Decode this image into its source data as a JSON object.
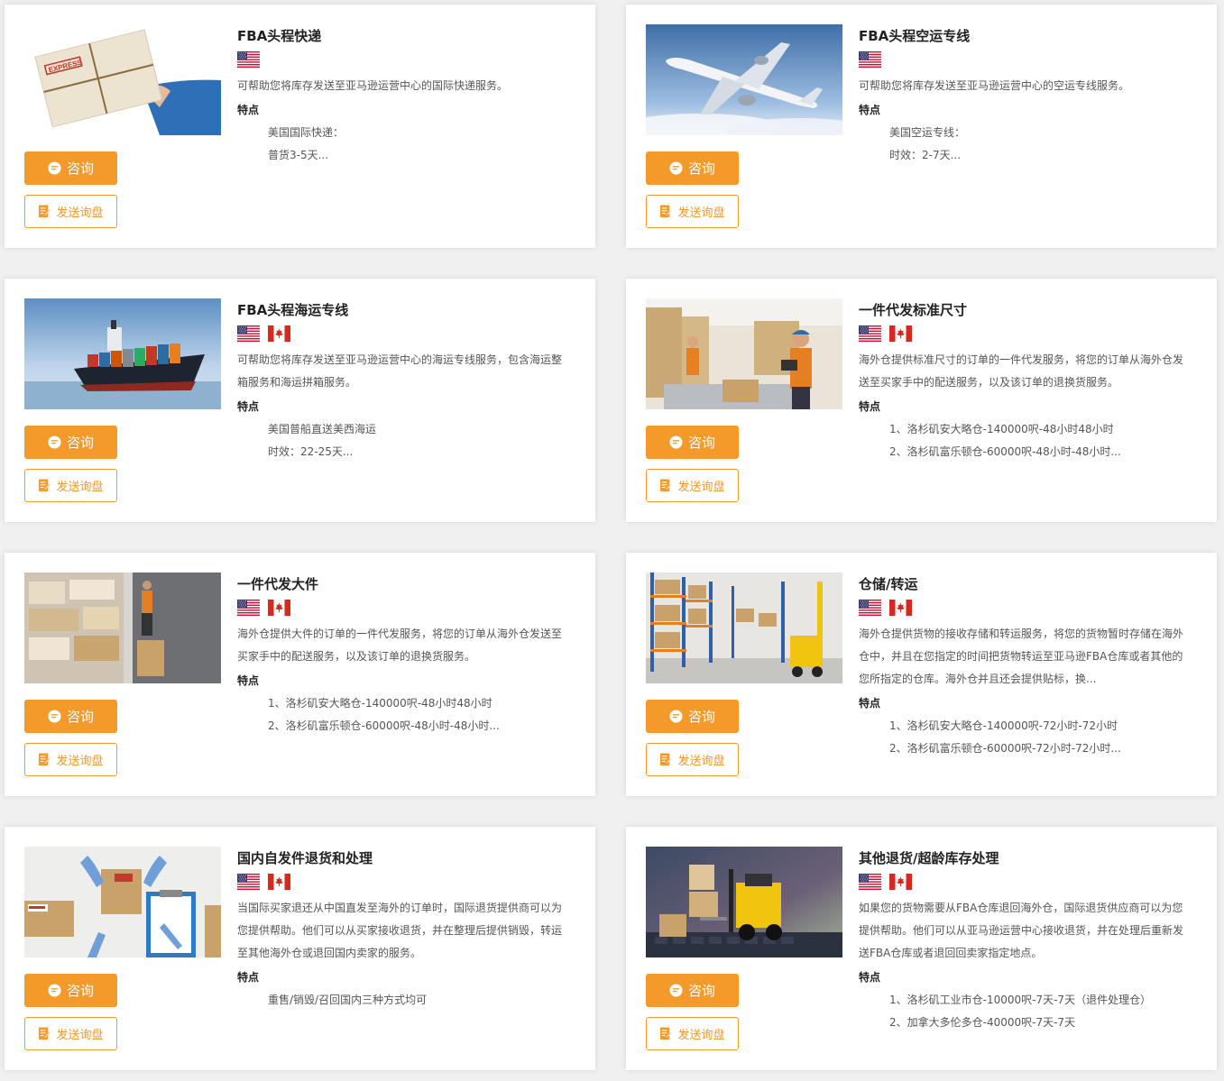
{
  "buttons": {
    "consult": "咨询",
    "inquiry": "发送询盘"
  },
  "features_label": "特点",
  "colors": {
    "accent": "#f39a2b"
  },
  "cards": [
    {
      "title": "FBA头程快递",
      "flags": [
        "us-flag"
      ],
      "image": "express-package-photo",
      "desc": "可帮助您将库存发送至亚马逊运营中心的国际快递服务。",
      "features": [
        "美国国际快递：",
        "普货3-5天..."
      ]
    },
    {
      "title": "FBA头程空运专线",
      "flags": [
        "us-flag"
      ],
      "image": "airplane-photo",
      "desc": "可帮助您将库存发送至亚马逊运营中心的空运专线服务。",
      "features": [
        "美国空运专线：",
        "时效：2-7天..."
      ]
    },
    {
      "title": "FBA头程海运专线",
      "flags": [
        "us-flag",
        "ca-flag"
      ],
      "image": "container-ship-photo",
      "desc": "可帮助您将库存发送至亚马逊运营中心的海运专线服务，包含海运整箱服务和海运拼箱服务。",
      "features": [
        "美国普船直送美西海运",
        "时效：22-25天..."
      ]
    },
    {
      "title": "一件代发标准尺寸",
      "flags": [
        "us-flag",
        "ca-flag"
      ],
      "image": "warehouse-worker-photo",
      "desc": "海外仓提供标准尺寸的订单的一件代发服务，将您的订单从海外仓发送至买家手中的配送服务，以及该订单的退换货服务。",
      "features": [
        "1、洛杉矶安大略仓-140000呎-48小时48小时",
        "2、洛杉矶富乐顿仓-60000呎-48小时-48小时..."
      ]
    },
    {
      "title": "一件代发大件",
      "flags": [
        "us-flag",
        "ca-flag"
      ],
      "image": "warehouse-boxes-photo",
      "desc": "海外仓提供大件的订单的一件代发服务，将您的订单从海外仓发送至买家手中的配送服务，以及该订单的退换货服务。",
      "features": [
        "1、洛杉矶安大略仓-140000呎-48小时48小时",
        "2、洛杉矶富乐顿仓-60000呎-48小时-48小时..."
      ]
    },
    {
      "title": "仓储/转运",
      "flags": [
        "us-flag",
        "ca-flag"
      ],
      "image": "warehouse-forklift-photo",
      "desc": "海外仓提供货物的接收存储和转运服务，将您的货物暂时存储在海外仓中，并且在您指定的时间把货物转运至亚马逊FBA仓库或者其他的您所指定的仓库。海外仓并且还会提供贴标，换...",
      "features": [
        "1、洛杉矶安大略仓-140000呎-72小时-72小时",
        "2、洛杉矶富乐顿仓-60000呎-72小时-72小时..."
      ]
    },
    {
      "title": "国内自发件退货和处理",
      "flags": [
        "us-flag",
        "ca-flag"
      ],
      "image": "return-package-photo",
      "desc": "当国际买家退还从中国直发至海外的订单时，国际退货提供商可以为您提供帮助。他们可以从买家接收退货，并在整理后提供销毁，转运至其他海外仓或退回国内卖家的服务。",
      "features": [
        "重售/销毁/召回国内三种方式均可"
      ]
    },
    {
      "title": "其他退货/超龄库存处理",
      "flags": [
        "us-flag",
        "ca-flag"
      ],
      "image": "toy-forklift-photo",
      "desc": "如果您的货物需要从FBA仓库退回海外仓，国际退货供应商可以为您提供帮助。他们可以从亚马逊运营中心接收退货，并在处理后重新发送FBA仓库或者退回回卖家指定地点。",
      "features": [
        "1、洛杉矶工业市仓-10000呎-7天-7天（退件处理仓）",
        "2、加拿大多伦多仓-40000呎-7天-7天"
      ]
    }
  ]
}
